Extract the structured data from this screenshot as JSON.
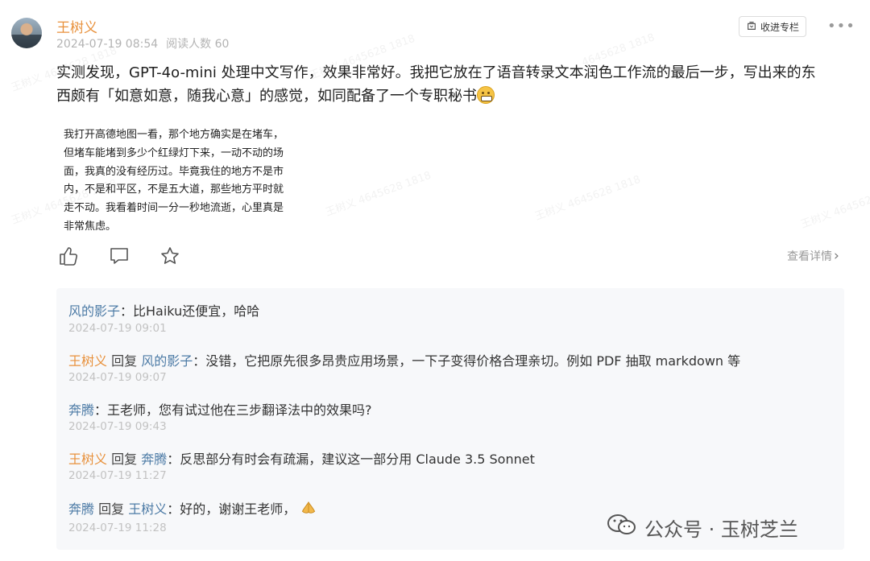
{
  "post": {
    "author": "王树义",
    "date": "2024-07-19 08:54",
    "read_count": "阅读人数 60",
    "collect_label": "收进专栏",
    "more_label": "•••",
    "content_line1": "实测发现，GPT-4o-mini 处理中文写作，效果非常好。我把它放在了语音转录文本润色工作流的最后一步，写出来的东",
    "content_line2": "西颇有「如意如意，随我心意」的感觉，如同配备了一个专职秘书",
    "quote_lines": [
      "我打开高德地图一看，那个地方确实是在堵车，",
      "但堵车能堵到多少个红绿灯下来，一动不动的场",
      "面，我真的没有经历过。毕竟我住的地方不是市",
      "内，不是和平区，不是五大道，那些地方平时就",
      "走不动。我看着时间一分一秒地流逝，心里真是",
      "非常焦虑。"
    ],
    "view_detail": "查看详情",
    "view_detail_arrow": "›"
  },
  "comments": [
    {
      "name": "风的影子",
      "reply_word": "",
      "reply_to": "",
      "text": "：比Haiku还便宜，哈哈",
      "date": "2024-07-19 09:01"
    },
    {
      "name": "王树义",
      "reply_word": "回复",
      "reply_to": "风的影子",
      "text": "：没错，它把原先很多昂贵应用场景，一下子变得价格合理亲切。例如 PDF 抽取 markdown 等",
      "date": "2024-07-19 09:07"
    },
    {
      "name": "奔腾",
      "reply_word": "",
      "reply_to": "",
      "text": "：王老师，您有试过他在三步翻译法中的效果吗?",
      "date": "2024-07-19 09:43"
    },
    {
      "name": "王树义",
      "reply_word": "回复",
      "reply_to": "奔腾",
      "text": "：反思部分有时会有疏漏，建议这一部分用 Claude 3.5 Sonnet",
      "date": "2024-07-19 11:27"
    },
    {
      "name": "奔腾",
      "reply_word": "回复",
      "reply_to": "王树义",
      "text": "：好的，谢谢王老师，",
      "date": "2024-07-19 11:28"
    }
  ],
  "watermarks": [
    "王树义 4645628 1818",
    "4645628 1818",
    "王树义 4645628 1818",
    "王树义 4645628 1818",
    "王树义 4645628 1818",
    "王树义 4645628 1818",
    "王树义 4645628 1818"
  ],
  "footer": {
    "wechat_label": "公众号 · 玉树芝兰"
  },
  "colors": {
    "author": "#e8913c",
    "commenter": "#4d7ba6",
    "muted": "#b3b3b3"
  },
  "icons": [
    "thumbs-up-icon",
    "comment-icon",
    "star-icon",
    "bookmark-icon",
    "wechat-icon",
    "folded-hands-icon",
    "grin-emoji-icon"
  ]
}
